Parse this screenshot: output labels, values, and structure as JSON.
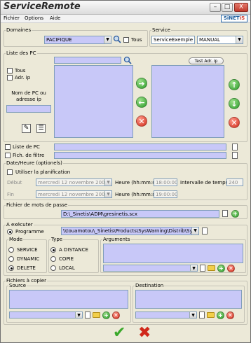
{
  "window": {
    "title": "ServiceRemote",
    "min": "–",
    "max": "□",
    "close": "X"
  },
  "menu": [
    "Fichier",
    "Options",
    "Aide"
  ],
  "logo": {
    "text_a": "SiNET",
    "text_b": "iS"
  },
  "domaines": {
    "legend": "Domaines",
    "value": "PACIFIQUE",
    "tous_label": "Tous"
  },
  "service": {
    "legend": "Service",
    "value": "ServiceExemple",
    "mode": "MANUAL"
  },
  "liste_pc": {
    "legend": "Liste des PC",
    "test_button": "Test Adr. ip",
    "tous_label": "Tous",
    "adr_ip_label": "Adr. ip",
    "nom_label": "Nom de PC ou adresse ip"
  },
  "file_rows": {
    "liste_pc": "Liste de PC",
    "filtre": "Fich. de filtre"
  },
  "date": {
    "legend": "Date/Heure (optionels)",
    "planif_label": "Utiliser la planification",
    "debut_label": "Début",
    "debut_value": "mercredi 12 novembre 2008",
    "heure_label": "Heure (hh:mm:ss)",
    "debut_heure": "18:00:00",
    "intervalle_label": "Intervalle de temps (s)",
    "intervalle_value": "240",
    "fin_label": "Fin",
    "fin_value": "mercredi 12 novembre 2008",
    "fin_heure": "19:00:00"
  },
  "password_file": {
    "legend": "Fichier de mots de passe",
    "value": "D:\\_Sinetis\\ADM\\gresinetis.scx"
  },
  "executer": {
    "legend": "A exécuter",
    "programme_label": "Programme",
    "programme_value": "\\\\touamotou\\_Sinetis\\Products\\SysWarning\\Distrib\\SysWarning\\S",
    "mode_legend": "Mode",
    "mode_options": [
      "SERVICE",
      "DYNAMIC",
      "DELETE"
    ],
    "type_legend": "Type",
    "type_options": [
      "A DISTANCE",
      "COPIE",
      "LOCAL"
    ],
    "arguments_legend": "Arguments"
  },
  "copier": {
    "legend": "Fichiers à copier",
    "source_legend": "Source",
    "destination_legend": "Destination"
  },
  "icons": {
    "ok": "✔",
    "cancel": "✖",
    "arrow_right": "➔",
    "arrow_left": "←",
    "arrow_up": "↑",
    "arrow_down": "↓",
    "plus": "+",
    "x": "✕"
  },
  "colors": {
    "list_bg": "#c8c8f8",
    "accent_green": "#2c9d2c",
    "accent_red": "#d02a1a"
  }
}
